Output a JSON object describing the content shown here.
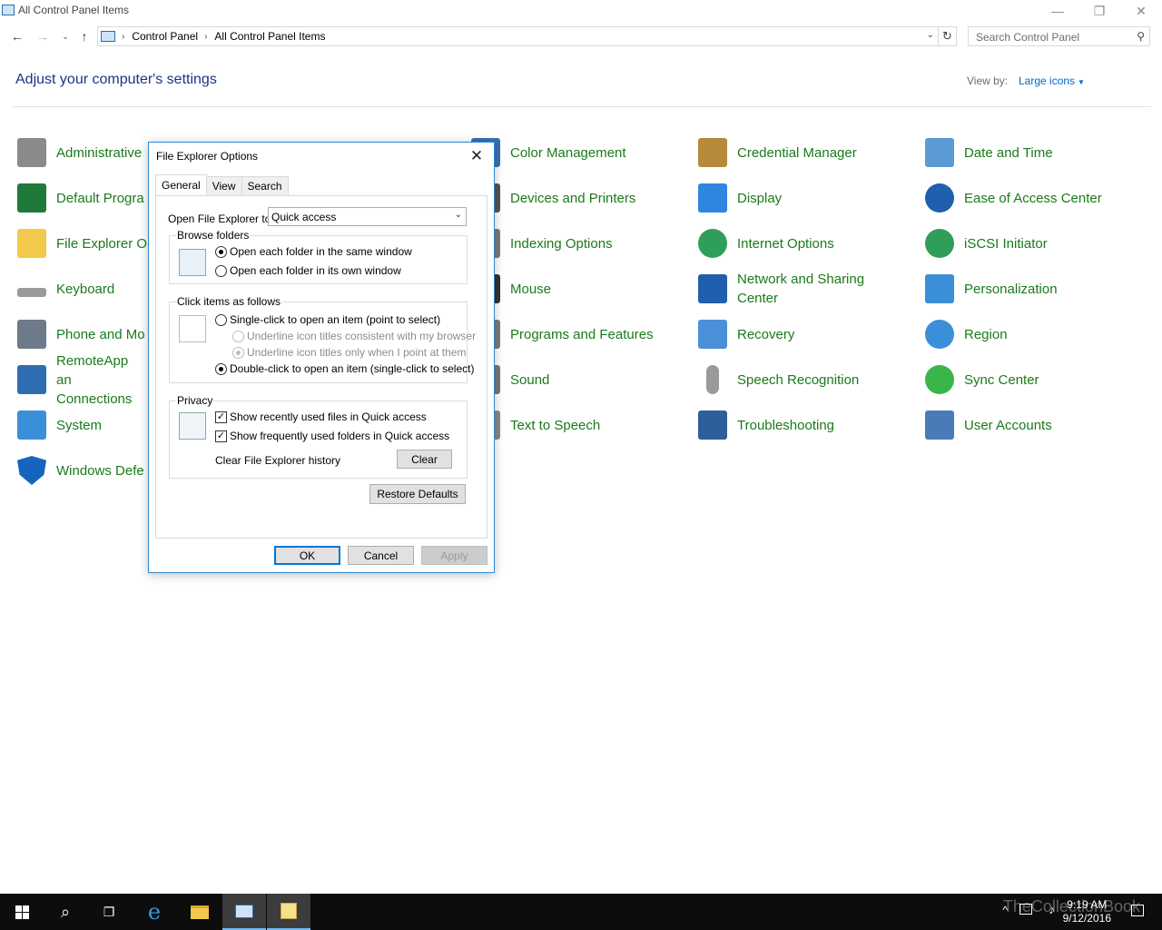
{
  "window": {
    "title": "All Control Panel Items",
    "min_glyph": "—",
    "max_glyph": "❐",
    "close_glyph": "✕"
  },
  "nav": {
    "back_glyph": "←",
    "forward_glyph": "→",
    "recent_glyph": "⌄",
    "up_glyph": "↑",
    "breadcrumbs": [
      "Control Panel",
      "All Control Panel Items"
    ],
    "sep_glyph": "›",
    "refresh_glyph": "↻",
    "search_placeholder": "Search Control Panel"
  },
  "header": {
    "title": "Adjust your computer's settings",
    "view_by_label": "View by:",
    "view_by_value": "Large icons"
  },
  "items": [
    {
      "label": "Administrative",
      "icon": "administrative-tools-icon",
      "color": "#8a8a8a"
    },
    {
      "label": "Default Progra",
      "icon": "default-programs-icon",
      "color": "#1f7a3a"
    },
    {
      "label": "File Explorer O",
      "icon": "file-explorer-options-icon",
      "color": "#f2c94c"
    },
    {
      "label": "Keyboard",
      "icon": "keyboard-icon",
      "color": "#9a9a9a"
    },
    {
      "label": "Phone and Mo",
      "icon": "phone-and-modem-icon",
      "color": "#6d7b8a"
    },
    {
      "label": "RemoteApp an Connections",
      "icon": "remoteapp-icon",
      "color": "#2f6db3"
    },
    {
      "label": "System",
      "icon": "system-icon",
      "color": "#3b8ed8"
    },
    {
      "label": "Windows Defe",
      "icon": "windows-defender-icon",
      "color": "#1565c0"
    },
    {
      "label": "Color Management",
      "icon": "color-management-icon",
      "color": "#3a6fb5"
    },
    {
      "label": "Devices and Printers",
      "icon": "devices-printers-icon",
      "color": "#555555"
    },
    {
      "label": "Indexing Options",
      "icon": "indexing-options-icon",
      "color": "#7a7a7a"
    },
    {
      "label": "Mouse",
      "icon": "mouse-icon",
      "color": "#333333"
    },
    {
      "label": "Programs and Features",
      "icon": "programs-features-icon",
      "color": "#7a7a7a"
    },
    {
      "label": "Sound",
      "icon": "sound-icon",
      "color": "#777777"
    },
    {
      "label": "Text to Speech",
      "icon": "text-to-speech-icon",
      "color": "#888888"
    },
    {
      "label": "Credential Manager",
      "icon": "credential-manager-icon",
      "color": "#b58a3a"
    },
    {
      "label": "Display",
      "icon": "display-icon",
      "color": "#2e86de"
    },
    {
      "label": "Internet Options",
      "icon": "internet-options-icon",
      "color": "#2f9e5a"
    },
    {
      "label": "Network and Sharing Center",
      "icon": "network-sharing-icon",
      "color": "#1f5fae"
    },
    {
      "label": "Recovery",
      "icon": "recovery-icon",
      "color": "#4a90d9"
    },
    {
      "label": "Speech Recognition",
      "icon": "microphone-icon",
      "color": "#9a9a9a"
    },
    {
      "label": "Troubleshooting",
      "icon": "troubleshooting-icon",
      "color": "#2d5f9a"
    },
    {
      "label": "Date and Time",
      "icon": "date-time-icon",
      "color": "#5b9bd5"
    },
    {
      "label": "Ease of Access Center",
      "icon": "ease-of-access-icon",
      "color": "#1f5fae"
    },
    {
      "label": "iSCSI Initiator",
      "icon": "iscsi-initiator-icon",
      "color": "#2f9e5a"
    },
    {
      "label": "Personalization",
      "icon": "personalization-icon",
      "color": "#3b8ed8"
    },
    {
      "label": "Region",
      "icon": "region-icon",
      "color": "#3a8fd8"
    },
    {
      "label": "Sync Center",
      "icon": "sync-center-icon",
      "color": "#3bb54a"
    },
    {
      "label": "User Accounts",
      "icon": "user-accounts-icon",
      "color": "#4a7ab8"
    }
  ],
  "dialog": {
    "title": "File Explorer Options",
    "close_glyph": "✕",
    "tabs": [
      "General",
      "View",
      "Search"
    ],
    "open_to_label": "Open File Explorer to:",
    "open_to_value": "Quick access",
    "browse": {
      "legend": "Browse folders",
      "same_window": "Open each folder in the same window",
      "own_window": "Open each folder in its own window"
    },
    "click": {
      "legend": "Click items as follows",
      "single": "Single-click to open an item (point to select)",
      "underline_browser": "Underline icon titles consistent with my browser",
      "underline_point": "Underline icon titles only when I point at them",
      "double": "Double-click to open an item (single-click to select)"
    },
    "privacy": {
      "legend": "Privacy",
      "recent_files": "Show recently used files in Quick access",
      "frequent_folders": "Show frequently used folders in Quick access",
      "clear_history_label": "Clear File Explorer history",
      "clear_button": "Clear"
    },
    "restore_defaults": "Restore Defaults",
    "ok": "OK",
    "cancel": "Cancel",
    "apply": "Apply"
  },
  "taskbar": {
    "time": "9:19 AM",
    "date": "9/12/2016",
    "watermark": "TheCollectionBook",
    "search_glyph": "⌕",
    "taskview_glyph": "❐",
    "ie_glyph": "e"
  },
  "colors": {
    "link_green": "#1a7a1a",
    "heading_blue": "#1e3287",
    "accent": "#0078d7"
  }
}
